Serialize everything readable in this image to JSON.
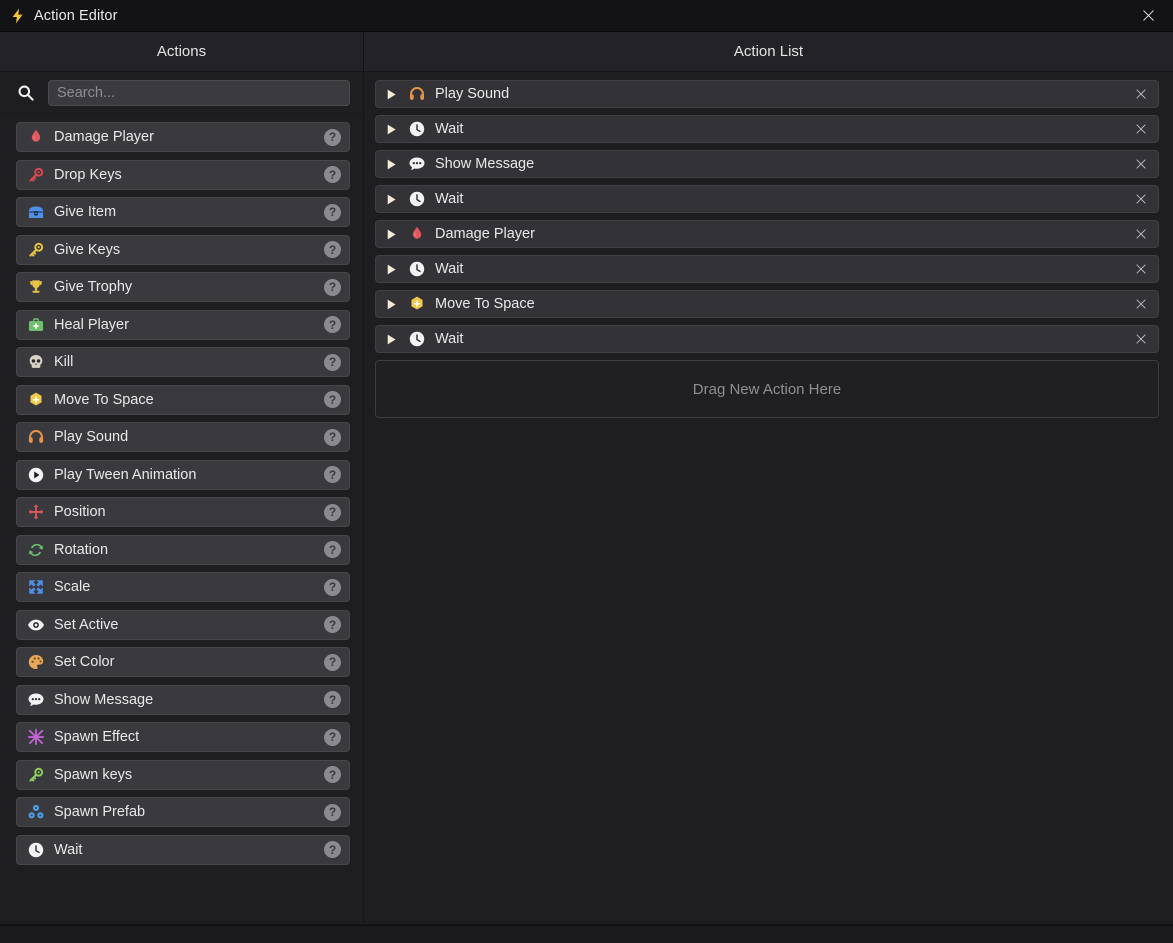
{
  "window": {
    "title": "Action Editor",
    "title_icon": "lightning-bolt-icon",
    "close_label": "✕"
  },
  "left_panel": {
    "header": "Actions",
    "search": {
      "icon": "search-icon",
      "placeholder": "Search...",
      "value": ""
    },
    "help_glyph": "?",
    "items": [
      {
        "label": "Damage Player",
        "icon": "blood-drop-icon",
        "color": "#e0575f"
      },
      {
        "label": "Drop Keys",
        "icon": "key-icon",
        "color": "#e0474f"
      },
      {
        "label": "Give Item",
        "icon": "treasure-chest-icon",
        "color": "#4f8fe8"
      },
      {
        "label": "Give Keys",
        "icon": "key-icon",
        "color": "#e8c444"
      },
      {
        "label": "Give Trophy",
        "icon": "trophy-icon",
        "color": "#e8c444"
      },
      {
        "label": "Heal Player",
        "icon": "medkit-icon",
        "color": "#6fbf6f"
      },
      {
        "label": "Kill",
        "icon": "skull-icon",
        "color": "#d8d2c4"
      },
      {
        "label": "Move To Space",
        "icon": "move-to-space-icon",
        "color": "#f0c94a"
      },
      {
        "label": "Play Sound",
        "icon": "headphones-icon",
        "color": "#e8954a"
      },
      {
        "label": "Play Tween Animation",
        "icon": "play-circle-icon",
        "color": "#f2f2f4"
      },
      {
        "label": "Position",
        "icon": "move-arrows-icon",
        "color": "#e0575f"
      },
      {
        "label": "Rotation",
        "icon": "rotate-icon",
        "color": "#6fbf6f"
      },
      {
        "label": "Scale",
        "icon": "scale-arrows-icon",
        "color": "#4f8fe8"
      },
      {
        "label": "Set Active",
        "icon": "eye-icon",
        "color": "#f2f2f4"
      },
      {
        "label": "Set Color",
        "icon": "palette-icon",
        "color": "#e8a85a"
      },
      {
        "label": "Show Message",
        "icon": "speech-bubble-icon",
        "color": "#f2f2f4"
      },
      {
        "label": "Spawn Effect",
        "icon": "sparkle-icon",
        "color": "#c264d8"
      },
      {
        "label": "Spawn keys",
        "icon": "key-icon",
        "color": "#8fd060"
      },
      {
        "label": "Spawn Prefab",
        "icon": "prefab-icon",
        "color": "#4f9fe8"
      },
      {
        "label": "Wait",
        "icon": "clock-icon",
        "color": "#f2f2f4"
      }
    ]
  },
  "right_panel": {
    "header": "Action List",
    "expand_icon": "play-triangle-icon",
    "remove_icon": "close-icon",
    "rows": [
      {
        "label": "Play Sound",
        "icon": "headphones-icon",
        "color": "#e8954a"
      },
      {
        "label": "Wait",
        "icon": "clock-icon",
        "color": "#f2f2f4"
      },
      {
        "label": "Show Message",
        "icon": "speech-bubble-icon",
        "color": "#f2f2f4"
      },
      {
        "label": "Wait",
        "icon": "clock-icon",
        "color": "#f2f2f4"
      },
      {
        "label": "Damage Player",
        "icon": "blood-drop-icon",
        "color": "#e0575f"
      },
      {
        "label": "Wait",
        "icon": "clock-icon",
        "color": "#f2f2f4"
      },
      {
        "label": "Move To Space",
        "icon": "move-to-space-icon",
        "color": "#f0c94a"
      },
      {
        "label": "Wait",
        "icon": "clock-icon",
        "color": "#f2f2f4"
      }
    ],
    "dropzone_label": "Drag New Action Here"
  },
  "colors": {
    "window_bg": "#232326",
    "panel_bg": "#1e1e21",
    "titlebar_bg": "#131316",
    "row_bg": "#3a3a3e",
    "action_row_bg": "#333337",
    "accent_yellow": "#f0c94a"
  }
}
